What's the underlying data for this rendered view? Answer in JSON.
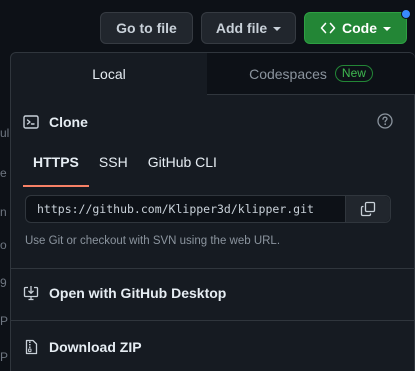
{
  "background": {
    "fragments": [
      "ul",
      "e",
      "n",
      "o",
      "9",
      "P",
      "P"
    ]
  },
  "toolbar": {
    "goto_label": "Go to file",
    "add_label": "Add file",
    "code_label": "Code",
    "code_icon": "code-brackets-icon"
  },
  "tabs": {
    "local": "Local",
    "codespaces": "Codespaces",
    "codespaces_badge": "New"
  },
  "clone": {
    "title": "Clone",
    "protocols": [
      "HTTPS",
      "SSH",
      "GitHub CLI"
    ],
    "active_protocol": "HTTPS",
    "url": "https://github.com/Klipper3d/klipper.git",
    "hint": "Use Git or checkout with SVN using the web URL."
  },
  "actions": {
    "desktop": "Open with GitHub Desktop",
    "zip": "Download ZIP"
  },
  "colors": {
    "accent_green": "#238636",
    "tab_underline": "#f78166",
    "badge_green": "#3fb950",
    "notification_dot": "#388bfd"
  }
}
